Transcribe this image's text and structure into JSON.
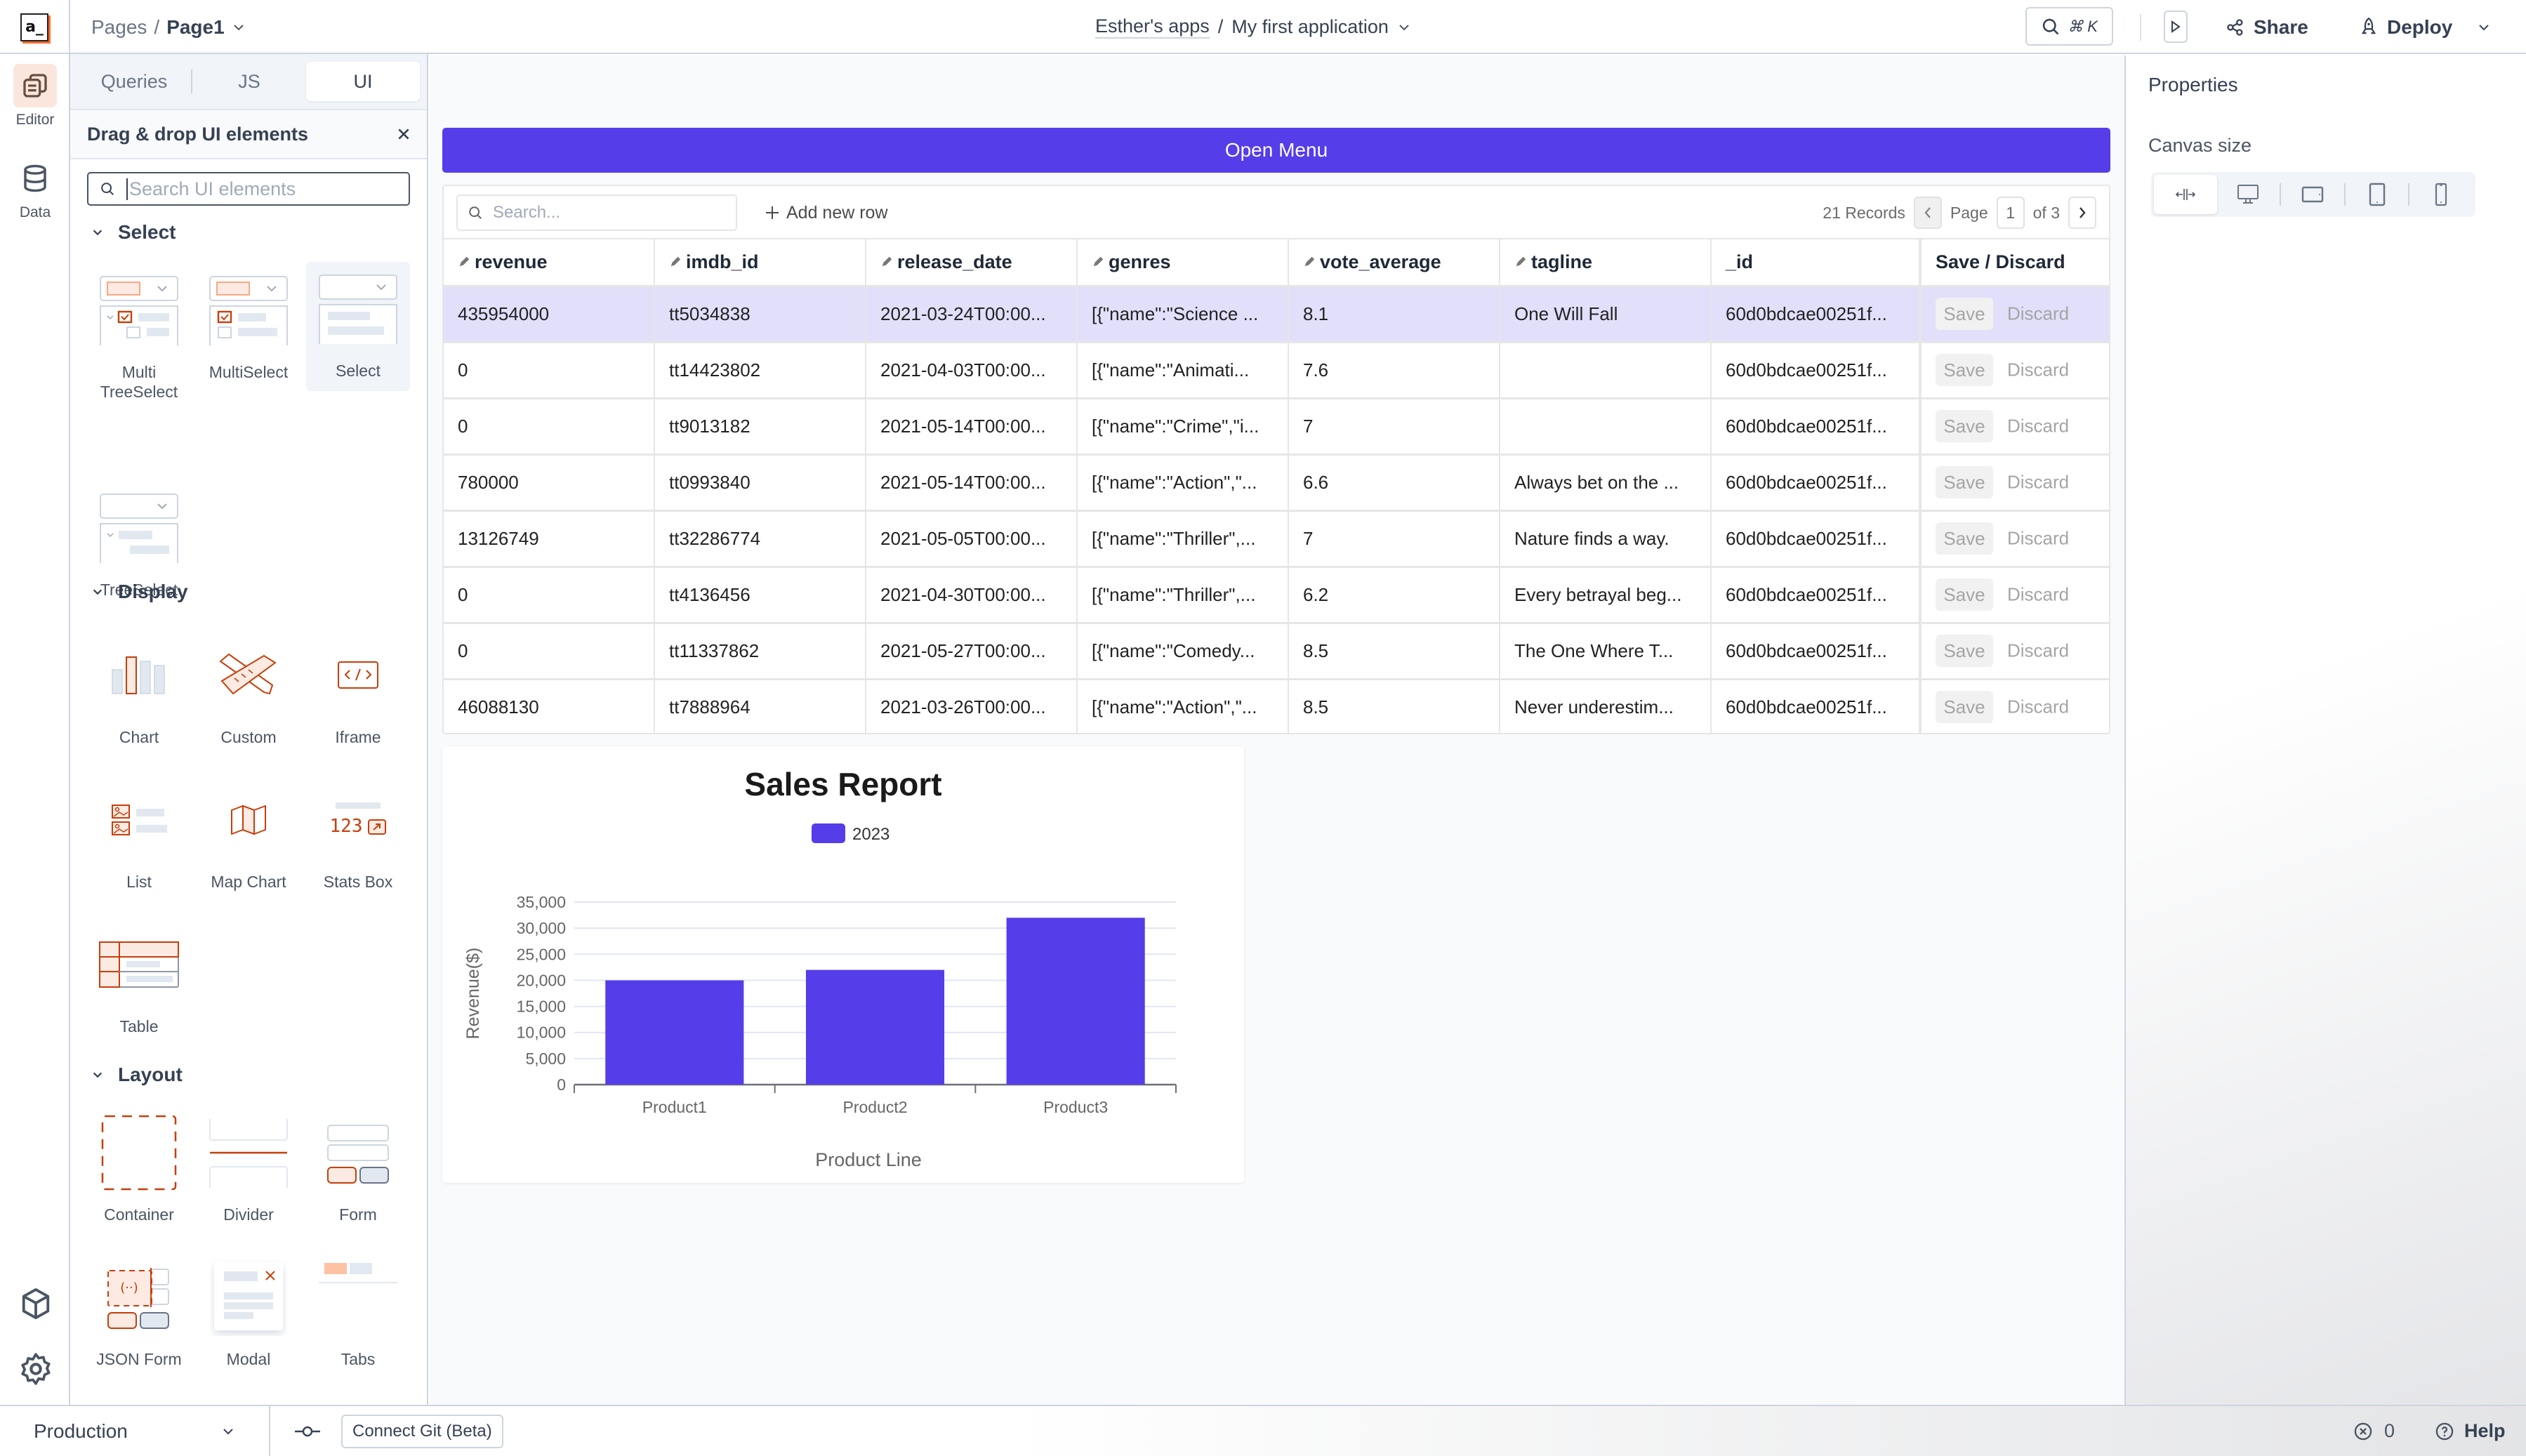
{
  "header": {
    "logo_text": "a_",
    "breadcrumb": {
      "root": "Pages",
      "separator": "/",
      "current": "Page1"
    },
    "app": {
      "workspace": "Esther's apps",
      "separator": "/",
      "name": "My first application"
    },
    "command_shortcut": "⌘ K",
    "share_label": "Share",
    "deploy_label": "Deploy"
  },
  "rail": {
    "items": [
      {
        "label": "Editor",
        "icon": "editor-pages-icon",
        "active": true
      },
      {
        "label": "Data",
        "icon": "database-icon",
        "active": false
      }
    ],
    "bottom_icons": [
      "package-cube-icon",
      "settings-gear-icon"
    ]
  },
  "panel": {
    "tabs": [
      {
        "label": "Queries",
        "active": false
      },
      {
        "label": "JS",
        "active": false
      },
      {
        "label": "UI",
        "active": true
      }
    ],
    "title": "Drag & drop UI elements",
    "search_placeholder": "Search UI elements",
    "sections": [
      {
        "title": "Select",
        "widgets": [
          {
            "label": "Multi TreeSelect",
            "icon": "multi-treeselect-icon"
          },
          {
            "label": "MultiSelect",
            "icon": "multiselect-icon"
          },
          {
            "label": "Select",
            "icon": "select-icon",
            "hovered": true
          },
          {
            "label": "TreeSelect",
            "icon": "treeselect-icon"
          }
        ]
      },
      {
        "title": "Display",
        "widgets": [
          {
            "label": "Chart",
            "icon": "chart-icon"
          },
          {
            "label": "Custom",
            "icon": "custom-widget-icon"
          },
          {
            "label": "Iframe",
            "icon": "iframe-code-icon"
          },
          {
            "label": "List",
            "icon": "list-icon"
          },
          {
            "label": "Map Chart",
            "icon": "map-icon"
          },
          {
            "label": "Stats Box",
            "icon": "stats-box-icon"
          },
          {
            "label": "Table",
            "icon": "table-icon"
          }
        ]
      },
      {
        "title": "Layout",
        "widgets": [
          {
            "label": "Container",
            "icon": "container-icon"
          },
          {
            "label": "Divider",
            "icon": "divider-icon"
          },
          {
            "label": "Form",
            "icon": "form-icon"
          },
          {
            "label": "JSON Form",
            "icon": "json-form-icon"
          },
          {
            "label": "Modal",
            "icon": "modal-icon"
          },
          {
            "label": "Tabs",
            "icon": "tabs-icon"
          }
        ]
      }
    ],
    "stats_box_number": "123"
  },
  "canvas": {
    "open_menu_label": "Open Menu",
    "table": {
      "search_placeholder": "Search...",
      "add_row_label": "Add new row",
      "records_label": "21 Records",
      "page_label": "Page",
      "page_current": "1",
      "page_total_label": "of 3",
      "columns": [
        {
          "label": "revenue",
          "editable": true
        },
        {
          "label": "imdb_id",
          "editable": true
        },
        {
          "label": "release_date",
          "editable": true
        },
        {
          "label": "genres",
          "editable": true
        },
        {
          "label": "vote_average",
          "editable": true
        },
        {
          "label": "tagline",
          "editable": true
        },
        {
          "label": "_id",
          "editable": false
        },
        {
          "label": "Save / Discard",
          "editable": false
        }
      ],
      "save_label": "Save",
      "discard_label": "Discard",
      "rows": [
        {
          "revenue": "435954000",
          "imdb_id": "tt5034838",
          "release_date": "2021-03-24T00:00...",
          "genres": "[{\"name\":\"Science ...",
          "vote_average": "8.1",
          "tagline": "One Will Fall",
          "_id": "60d0bdcae00251f...",
          "selected": true
        },
        {
          "revenue": "0",
          "imdb_id": "tt14423802",
          "release_date": "2021-04-03T00:00...",
          "genres": "[{\"name\":\"Animati...",
          "vote_average": "7.6",
          "tagline": "",
          "_id": "60d0bdcae00251f..."
        },
        {
          "revenue": "0",
          "imdb_id": "tt9013182",
          "release_date": "2021-05-14T00:00...",
          "genres": "[{\"name\":\"Crime\",\"i...",
          "vote_average": "7",
          "tagline": "",
          "_id": "60d0bdcae00251f..."
        },
        {
          "revenue": "780000",
          "imdb_id": "tt0993840",
          "release_date": "2021-05-14T00:00...",
          "genres": "[{\"name\":\"Action\",\"...",
          "vote_average": "6.6",
          "tagline": "Always bet on the ...",
          "_id": "60d0bdcae00251f..."
        },
        {
          "revenue": "13126749",
          "imdb_id": "tt32286774",
          "release_date": "2021-05-05T00:00...",
          "genres": "[{\"name\":\"Thriller\",...",
          "vote_average": "7",
          "tagline": "Nature finds a way.",
          "_id": "60d0bdcae00251f..."
        },
        {
          "revenue": "0",
          "imdb_id": "tt4136456",
          "release_date": "2021-04-30T00:00...",
          "genres": "[{\"name\":\"Thriller\",...",
          "vote_average": "6.2",
          "tagline": "Every betrayal beg...",
          "_id": "60d0bdcae00251f..."
        },
        {
          "revenue": "0",
          "imdb_id": "tt11337862",
          "release_date": "2021-05-27T00:00...",
          "genres": "[{\"name\":\"Comedy...",
          "vote_average": "8.5",
          "tagline": "The One Where T...",
          "_id": "60d0bdcae00251f..."
        },
        {
          "revenue": "46088130",
          "imdb_id": "tt7888964",
          "release_date": "2021-03-26T00:00...",
          "genres": "[{\"name\":\"Action\",\"...",
          "vote_average": "8.5",
          "tagline": "Never underestim...",
          "_id": "60d0bdcae00251f..."
        }
      ]
    }
  },
  "chart_data": {
    "type": "bar",
    "title": "Sales Report",
    "categories": [
      "Product1",
      "Product2",
      "Product3"
    ],
    "series": [
      {
        "name": "2023",
        "values": [
          20000,
          22000,
          32000
        ],
        "color": "#553de9"
      }
    ],
    "xlabel": "Product Line",
    "ylabel": "Revenue($)",
    "ylim": [
      0,
      35000
    ],
    "yticks": [
      0,
      5000,
      10000,
      15000,
      20000,
      25000,
      30000,
      35000
    ],
    "ytick_labels": [
      "0",
      "5,000",
      "10,000",
      "15,000",
      "20,000",
      "25,000",
      "30,000",
      "35,000"
    ],
    "grid": true,
    "legend": "top-center"
  },
  "properties": {
    "title": "Properties",
    "canvas_size_label": "Canvas size",
    "canvas_size_options": [
      {
        "icon": "fluid-width-icon",
        "active": true
      },
      {
        "icon": "desktop-icon",
        "active": false
      },
      {
        "icon": "tablet-landscape-icon",
        "active": false
      },
      {
        "icon": "tablet-portrait-icon",
        "active": false
      },
      {
        "icon": "mobile-icon",
        "active": false
      }
    ]
  },
  "bottombar": {
    "environment": "Production",
    "git_label": "Connect Git (Beta)",
    "error_count": "0",
    "help_label": "Help"
  },
  "colors": {
    "accent": "#553de9",
    "brand_orange": "#ff6b2c",
    "widget_icon": "#c73e0a",
    "selected_row": "#e1dffa"
  }
}
